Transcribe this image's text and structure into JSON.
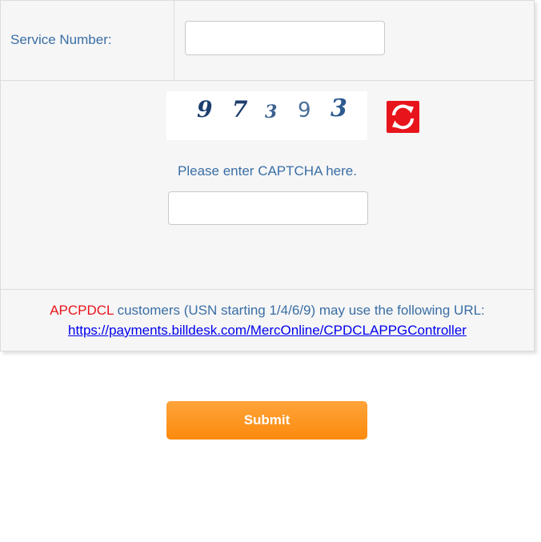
{
  "service_row": {
    "label": "Service Number:",
    "input_value": "",
    "input_placeholder": ""
  },
  "captcha": {
    "digits": [
      "9",
      "7",
      "3",
      "9",
      "3"
    ],
    "refresh_icon": "refresh-icon",
    "prompt": "Please enter CAPTCHA here.",
    "input_value": "",
    "input_placeholder": ""
  },
  "info": {
    "brand": "APCPDCL",
    "message": " customers (USN starting 1/4/6/9) may use the following URL:",
    "url": "https://payments.billdesk.com/MercOnline/CPDCLAPPGController"
  },
  "submit_label": "Submit",
  "colors": {
    "label_text": "#3a6ea5",
    "brand_red": "#e8141b",
    "link": "#0000ee",
    "submit_orange": "#fb8a0d",
    "panel_bg": "#f6f6f6"
  }
}
